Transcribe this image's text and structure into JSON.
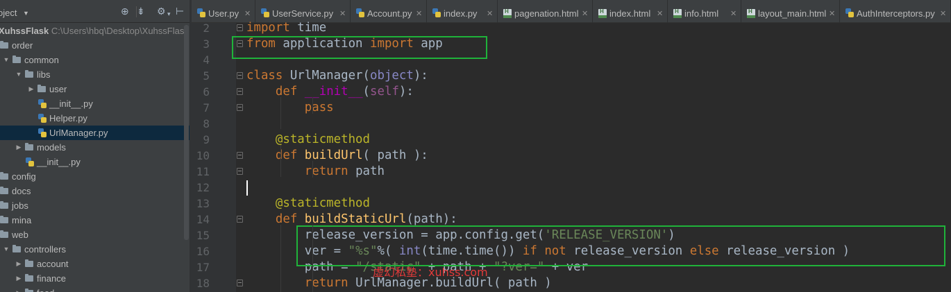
{
  "sidebar": {
    "title": "oject",
    "tree": [
      {
        "label": "XuhssFlask",
        "path": "C:\\Users\\hbq\\Desktop\\XuhssFlask",
        "kind": "root"
      },
      {
        "label": "order",
        "kind": "folder",
        "expanded": true
      },
      {
        "label": "common",
        "kind": "folder",
        "expanded": true
      },
      {
        "label": "libs",
        "kind": "folder",
        "expanded": true
      },
      {
        "label": "user",
        "kind": "folder",
        "expanded": false
      },
      {
        "label": "__init__.py",
        "kind": "py"
      },
      {
        "label": "Helper.py",
        "kind": "py"
      },
      {
        "label": "UrlManager.py",
        "kind": "py",
        "selected": true
      },
      {
        "label": "models",
        "kind": "folder",
        "expanded": false
      },
      {
        "label": "__init__.py",
        "kind": "py"
      },
      {
        "label": "config",
        "kind": "folder",
        "expanded": false
      },
      {
        "label": "docs",
        "kind": "folder",
        "expanded": false
      },
      {
        "label": "jobs",
        "kind": "folder",
        "expanded": false
      },
      {
        "label": "mina",
        "kind": "folder",
        "expanded": false
      },
      {
        "label": "web",
        "kind": "folder",
        "expanded": true
      },
      {
        "label": "controllers",
        "kind": "folder",
        "expanded": true
      },
      {
        "label": "account",
        "kind": "folder",
        "expanded": false
      },
      {
        "label": "finance",
        "kind": "folder",
        "expanded": false
      },
      {
        "label": "food",
        "kind": "folder",
        "expanded": false
      }
    ]
  },
  "tabs": [
    {
      "label": "User.py",
      "icon": "python-icon"
    },
    {
      "label": "UserService.py",
      "icon": "python-icon"
    },
    {
      "label": "Account.py",
      "icon": "python-icon"
    },
    {
      "label": "index.py",
      "icon": "python-icon"
    },
    {
      "label": "pagenation.html",
      "icon": "html-icon"
    },
    {
      "label": "index.html",
      "icon": "html-icon"
    },
    {
      "label": "info.html",
      "icon": "html-icon"
    },
    {
      "label": "layout_main.html",
      "icon": "html-icon"
    },
    {
      "label": "AuthInterceptors.py",
      "icon": "python-icon"
    }
  ],
  "editor": {
    "lines": [
      {
        "n": "2",
        "tokens": [
          [
            "kw",
            "import "
          ],
          [
            "id",
            "time"
          ]
        ]
      },
      {
        "n": "3",
        "tokens": [
          [
            "kw",
            "from "
          ],
          [
            "id",
            "application "
          ],
          [
            "kw",
            "import "
          ],
          [
            "id",
            "app"
          ]
        ]
      },
      {
        "n": "4",
        "tokens": []
      },
      {
        "n": "5",
        "tokens": [
          [
            "kw",
            "class "
          ],
          [
            "id",
            "UrlManager("
          ],
          [
            "builtin",
            "object"
          ],
          [
            "id",
            "):"
          ]
        ]
      },
      {
        "n": "6",
        "tokens": [
          [
            "id",
            "    "
          ],
          [
            "kw",
            "def "
          ],
          [
            "magic",
            "__init__"
          ],
          [
            "id",
            "("
          ],
          [
            "self",
            "self"
          ],
          [
            "id",
            "):"
          ]
        ]
      },
      {
        "n": "7",
        "tokens": [
          [
            "id",
            "        "
          ],
          [
            "kw",
            "pass"
          ]
        ]
      },
      {
        "n": "8",
        "tokens": []
      },
      {
        "n": "9",
        "tokens": [
          [
            "id",
            "    "
          ],
          [
            "dec",
            "@staticmethod"
          ]
        ]
      },
      {
        "n": "10",
        "tokens": [
          [
            "id",
            "    "
          ],
          [
            "kw",
            "def "
          ],
          [
            "fn",
            "buildUrl"
          ],
          [
            "id",
            "( path ):"
          ]
        ]
      },
      {
        "n": "11",
        "tokens": [
          [
            "id",
            "        "
          ],
          [
            "kw",
            "return "
          ],
          [
            "id",
            "path"
          ]
        ]
      },
      {
        "n": "12",
        "tokens": []
      },
      {
        "n": "13",
        "tokens": [
          [
            "id",
            "    "
          ],
          [
            "dec",
            "@staticmethod"
          ]
        ]
      },
      {
        "n": "14",
        "tokens": [
          [
            "id",
            "    "
          ],
          [
            "kw",
            "def "
          ],
          [
            "fn",
            "buildStaticUrl"
          ],
          [
            "id",
            "(path):"
          ]
        ]
      },
      {
        "n": "15",
        "tokens": [
          [
            "id",
            "        release_version = app.config.get("
          ],
          [
            "str",
            "'RELEASE_VERSION'"
          ],
          [
            "id",
            ")"
          ]
        ]
      },
      {
        "n": "16",
        "tokens": [
          [
            "id",
            "        ver = "
          ],
          [
            "str",
            "\"%s\""
          ],
          [
            "id",
            "%( "
          ],
          [
            "builtin",
            "int"
          ],
          [
            "id",
            "(time.time()) "
          ],
          [
            "kw",
            "if not "
          ],
          [
            "id",
            "release_version "
          ],
          [
            "kw",
            "else "
          ],
          [
            "id",
            "release_version )"
          ]
        ]
      },
      {
        "n": "17",
        "tokens": [
          [
            "id",
            "        path = "
          ],
          [
            "str",
            "\"/static\""
          ],
          [
            "id",
            " + path + "
          ],
          [
            "str",
            "\"?ver=\""
          ],
          [
            "id",
            " + ver"
          ]
        ]
      },
      {
        "n": "18",
        "tokens": [
          [
            "id",
            "        "
          ],
          [
            "kw",
            "return "
          ],
          [
            "id",
            "UrlManager.buildUrl( path )"
          ]
        ]
      }
    ]
  },
  "watermark": "虚幻私塾：xuhss.com"
}
